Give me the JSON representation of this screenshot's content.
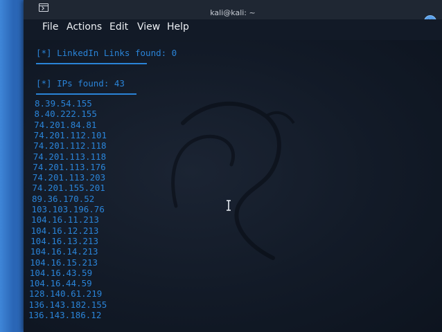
{
  "window": {
    "title": "kali@kali: ~"
  },
  "menubar": {
    "items": [
      "File",
      "Actions",
      "Edit",
      "View",
      "Help"
    ]
  },
  "terminal": {
    "linkedin_line": "[*] LinkedIn Links found: 0",
    "ips_line": "[*] IPs found: 43",
    "ips": [
      "8.39.54.155",
      "8.40.222.155",
      "74.201.84.81",
      "74.201.112.101",
      "74.201.112.118",
      "74.201.113.118",
      "74.201.113.176",
      "74.201.113.203",
      "74.201.155.201",
      "89.36.170.52",
      "103.103.196.76",
      "104.16.11.213",
      "104.16.12.213",
      "104.16.13.213",
      "104.16.14.213",
      "104.16.15.213",
      "104.16.43.59",
      "104.16.44.59",
      "128.140.61.219",
      "136.143.182.155",
      "136.143.186.12"
    ]
  },
  "colors": {
    "terminal_text": "#2a84d8",
    "terminal_bg": "#121a27",
    "titlebar_bg": "#1f2733",
    "close_button": "#5aa0ea",
    "desktop": "#2f6fb8"
  },
  "icons": {
    "window_icon": "terminal-window-icon",
    "close": "close-icon",
    "pointer": "text-cursor-icon"
  }
}
